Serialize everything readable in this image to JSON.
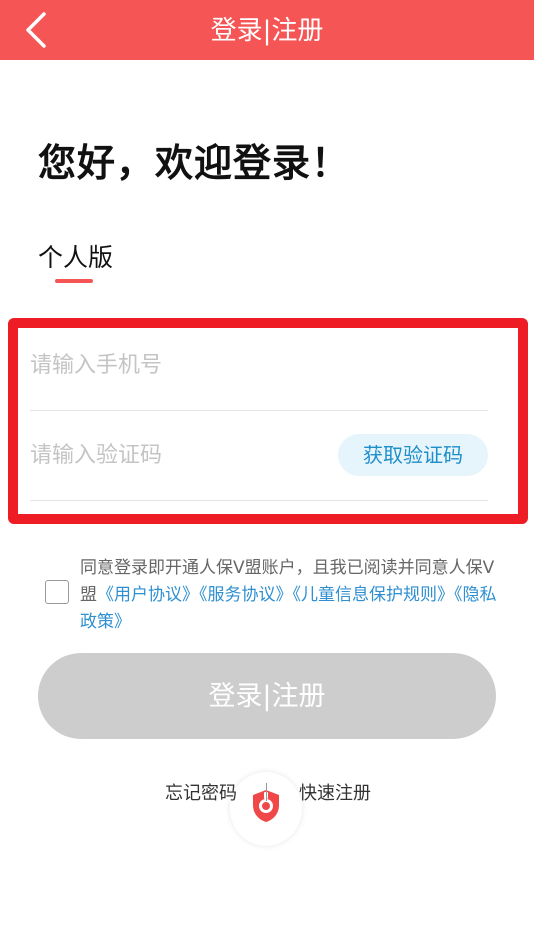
{
  "header": {
    "title": "登录|注册",
    "back_icon": "chevron-left-icon",
    "background_color": "#f55555"
  },
  "greeting": "您好，欢迎登录！",
  "tab": {
    "label": "个人版"
  },
  "form": {
    "phone_placeholder": "请输入手机号",
    "code_placeholder": "请输入验证码",
    "get_code_label": "获取验证码"
  },
  "agreement": {
    "checked": false,
    "text_prefix": "同意登录即开通人保V盟账户，且我已阅读并同意人保V盟",
    "links": [
      "《用户协议》",
      "《服务协议》",
      "《儿童信息保护规则》",
      "《隐私政策》"
    ],
    "link_color": "#2f8fd0"
  },
  "login_button": {
    "label": "登录|注册"
  },
  "links": {
    "forgot_password": "忘记密码",
    "quick_register": "快速注册"
  }
}
